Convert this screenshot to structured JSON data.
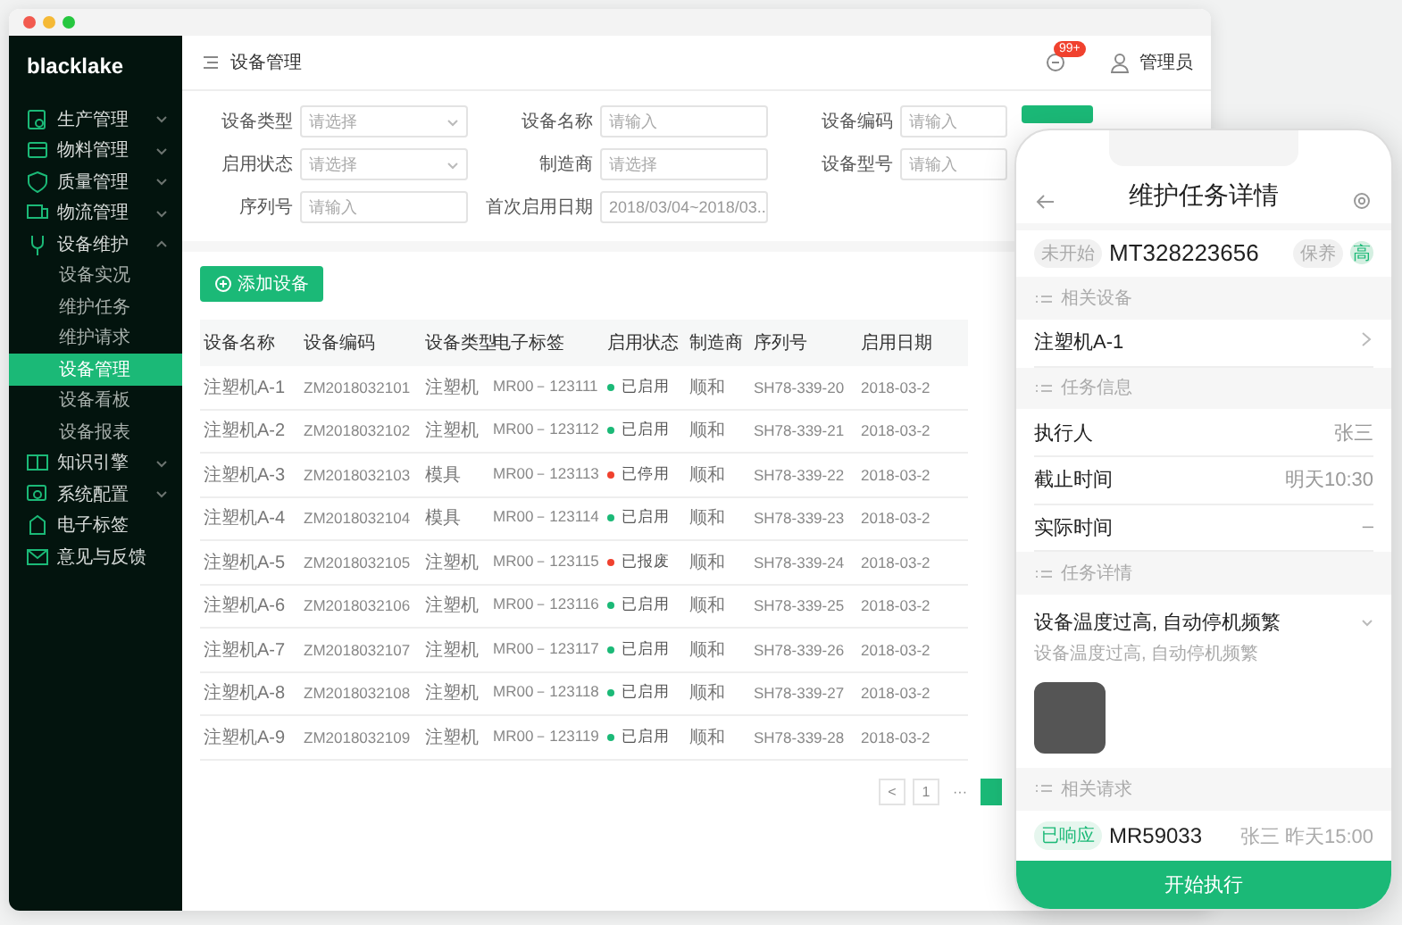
{
  "sidebar": {
    "logo": "blacklake",
    "items": [
      {
        "label": "生产管理",
        "expanded": false
      },
      {
        "label": "物料管理",
        "expanded": false
      },
      {
        "label": "质量管理",
        "expanded": false
      },
      {
        "label": "物流管理",
        "expanded": false
      },
      {
        "label": "设备维护",
        "expanded": true,
        "children": [
          {
            "label": "设备实况",
            "selected": false
          },
          {
            "label": "维护任务",
            "selected": false
          },
          {
            "label": "维护请求",
            "selected": false
          },
          {
            "label": "设备管理",
            "selected": true
          },
          {
            "label": "设备看板",
            "selected": false
          },
          {
            "label": "设备报表",
            "selected": false
          }
        ]
      },
      {
        "label": "知识引擎",
        "expanded": false
      },
      {
        "label": "系统配置",
        "expanded": false
      },
      {
        "label": "电子标签"
      },
      {
        "label": "意见与反馈"
      }
    ]
  },
  "topbar": {
    "title": "设备管理",
    "badge": "99+",
    "user": "管理员"
  },
  "filters": [
    {
      "label": "设备类型",
      "kind": "select",
      "placeholder": "请选择"
    },
    {
      "label": "设备名称",
      "kind": "input",
      "placeholder": "请输入"
    },
    {
      "label": "设备编码",
      "kind": "input",
      "placeholder": "请输入"
    },
    {
      "label": "启用状态",
      "kind": "select",
      "placeholder": "请选择"
    },
    {
      "label": "制造商",
      "kind": "input",
      "placeholder": "请选择"
    },
    {
      "label": "设备型号",
      "kind": "input",
      "placeholder": "请输入"
    },
    {
      "label": "序列号",
      "kind": "input",
      "placeholder": "请输入"
    },
    {
      "label": "首次启用日期",
      "kind": "date",
      "value": "2018/03/04~2018/03.."
    }
  ],
  "add_button": "添加设备",
  "table": {
    "columns": [
      "设备名称",
      "设备编码",
      "设备类型",
      "电子标签",
      "启用状态",
      "制造商",
      "序列号",
      "启用日期"
    ],
    "rows": [
      {
        "cells": [
          "注塑机A-1",
          "ZM2018032101",
          "注塑机",
          "MR00－123111",
          "已启用",
          "顺和",
          "SH78-339-20",
          "2018-03-2"
        ],
        "color": "#1bb977"
      },
      {
        "cells": [
          "注塑机A-2",
          "ZM2018032102",
          "注塑机",
          "MR00－123112",
          "已启用",
          "顺和",
          "SH78-339-21",
          "2018-03-2"
        ],
        "color": "#1bb977"
      },
      {
        "cells": [
          "注塑机A-3",
          "ZM2018032103",
          "模具",
          "MR00－123113",
          "已停用",
          "顺和",
          "SH78-339-22",
          "2018-03-2"
        ],
        "color": "#f0412e"
      },
      {
        "cells": [
          "注塑机A-4",
          "ZM2018032104",
          "模具",
          "MR00－123114",
          "已启用",
          "顺和",
          "SH78-339-23",
          "2018-03-2"
        ],
        "color": "#1bb977"
      },
      {
        "cells": [
          "注塑机A-5",
          "ZM2018032105",
          "注塑机",
          "MR00－123115",
          "已报废",
          "顺和",
          "SH78-339-24",
          "2018-03-2"
        ],
        "color": "#f0412e"
      },
      {
        "cells": [
          "注塑机A-6",
          "ZM2018032106",
          "注塑机",
          "MR00－123116",
          "已启用",
          "顺和",
          "SH78-339-25",
          "2018-03-2"
        ],
        "color": "#1bb977"
      },
      {
        "cells": [
          "注塑机A-7",
          "ZM2018032107",
          "注塑机",
          "MR00－123117",
          "已启用",
          "顺和",
          "SH78-339-26",
          "2018-03-2"
        ],
        "color": "#1bb977"
      },
      {
        "cells": [
          "注塑机A-8",
          "ZM2018032108",
          "注塑机",
          "MR00－123118",
          "已启用",
          "顺和",
          "SH78-339-27",
          "2018-03-2"
        ],
        "color": "#1bb977"
      },
      {
        "cells": [
          "注塑机A-9",
          "ZM2018032109",
          "注塑机",
          "MR00－123119",
          "已启用",
          "顺和",
          "SH78-339-28",
          "2018-03-2"
        ],
        "color": "#1bb977"
      }
    ]
  },
  "pagination": [
    {
      "label": "<",
      "kind": "prev"
    },
    {
      "label": "1",
      "kind": "page"
    },
    {
      "label": "···",
      "kind": "ellipsis"
    }
  ],
  "phone": {
    "title": "维护任务详情",
    "status_tag": "未开始",
    "task_id": "MT328223656",
    "type_tag": "保养",
    "priority": "高",
    "sections": [
      {
        "heading": "相关设备",
        "kind": "link",
        "rows": [
          {
            "label": "注塑机A-1"
          }
        ]
      },
      {
        "heading": "任务信息",
        "kind": "fields",
        "rows": [
          {
            "label": "执行人",
            "value": "张三"
          },
          {
            "label": "截止时间",
            "value": "明天10:30"
          },
          {
            "label": "实际时间",
            "value": "–"
          }
        ]
      },
      {
        "heading": "任务详情",
        "kind": "detail",
        "title": "设备温度过高, 自动停机频繁",
        "description": "设备温度过高, 自动停机频繁"
      },
      {
        "heading": "相关请求",
        "kind": "request",
        "tag": "已响应",
        "request_id": "MR59033",
        "meta": "张三 昨天15:00"
      }
    ],
    "action": "开始执行"
  }
}
